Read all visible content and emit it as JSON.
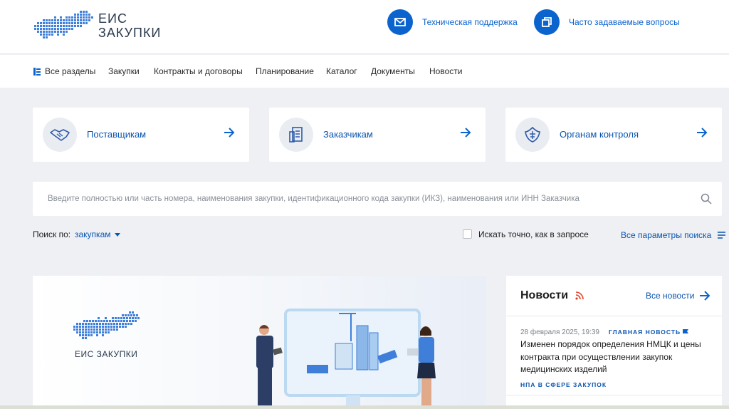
{
  "header": {
    "logo_line1": "ЕИС",
    "logo_line2": "ЗАКУПКИ",
    "support_label": "Техническая поддержка",
    "faq_label": "Часто задаваемые вопросы"
  },
  "nav": {
    "all_sections": "Все разделы",
    "items": [
      "Закупки",
      "Контракты и договоры",
      "Планирование",
      "Каталог",
      "Документы",
      "Новости"
    ]
  },
  "cards": [
    {
      "label": "Поставщикам",
      "icon": "handshake-icon"
    },
    {
      "label": "Заказчикам",
      "icon": "document-icon"
    },
    {
      "label": "Органам контроля",
      "icon": "emblem-icon"
    }
  ],
  "search": {
    "placeholder": "Введите полностью или часть номера, наименования закупки, идентификационного кода закупки (ИКЗ), наименования или ИНН Заказчика",
    "value": ""
  },
  "options": {
    "search_by_label": "Поиск по:",
    "search_by_value": "закупкам",
    "exact_label": "Искать точно, как в запросе",
    "all_params_label": "Все параметры поиска"
  },
  "banner": {
    "logo_text": "ЕИС ЗАКУПКИ"
  },
  "news": {
    "title": "Новости",
    "all_link": "Все новости",
    "items": [
      {
        "date": "28 февраля 2025, 19:39",
        "tag": "ГЛАВНАЯ НОВОСТЬ",
        "text": "Изменен порядок определения НМЦК и цены контракта при осуществлении закупок медицинских изделий",
        "category": "НПА В СФЕРЕ ЗАКУПОК"
      }
    ]
  },
  "colors": {
    "accent": "#0b63ce",
    "link": "#0b55b0",
    "background": "#eef0f3"
  }
}
